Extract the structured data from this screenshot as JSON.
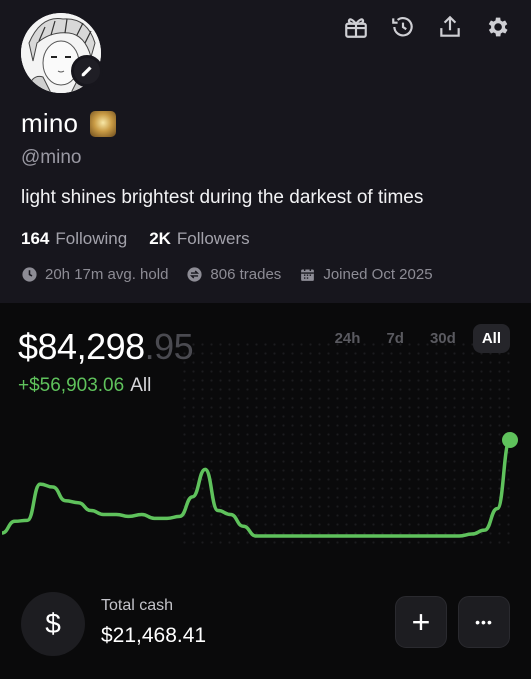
{
  "profile": {
    "name": "mino",
    "handle": "@mino",
    "bio": "light shines brightest during the darkest of times",
    "following_count": "164",
    "following_label": "Following",
    "followers_count": "2K",
    "followers_label": "Followers",
    "avg_hold": "20h 17m avg. hold",
    "trades": "806 trades",
    "joined": "Joined Oct 2025"
  },
  "header_icons": [
    "gift-icon",
    "history-icon",
    "share-icon",
    "settings-icon"
  ],
  "portfolio": {
    "value_main": "$84,298",
    "value_decimal": ".95",
    "change_amount": "+$56,903.06",
    "change_period": "All",
    "ranges": [
      "24h",
      "7d",
      "30d",
      "All"
    ],
    "active_range": "All",
    "accent_color": "#5fc25c"
  },
  "chart_data": {
    "type": "line",
    "x": [
      0,
      1,
      2,
      3,
      4,
      5,
      6,
      7,
      8,
      9,
      10,
      11,
      12,
      13,
      14,
      15,
      16,
      17,
      18,
      19,
      20,
      21,
      22,
      23,
      24,
      25,
      26,
      27,
      28,
      29,
      30,
      31,
      32,
      33,
      34,
      35,
      36,
      37,
      38,
      39,
      40
    ],
    "values": [
      5,
      17,
      18,
      55,
      52,
      38,
      36,
      28,
      24,
      24,
      22,
      24,
      20,
      20,
      22,
      42,
      70,
      28,
      24,
      12,
      2,
      2,
      2,
      2,
      2,
      2,
      2,
      2,
      2,
      2,
      2,
      2,
      2,
      2,
      2,
      2,
      2,
      4,
      8,
      30,
      100
    ],
    "title": "",
    "xlabel": "",
    "ylabel": ""
  },
  "cash": {
    "label": "Total cash",
    "value": "$21,468.41",
    "icon_symbol": "$"
  },
  "actions": {
    "add_symbol": "+",
    "more_symbol": "•••"
  }
}
